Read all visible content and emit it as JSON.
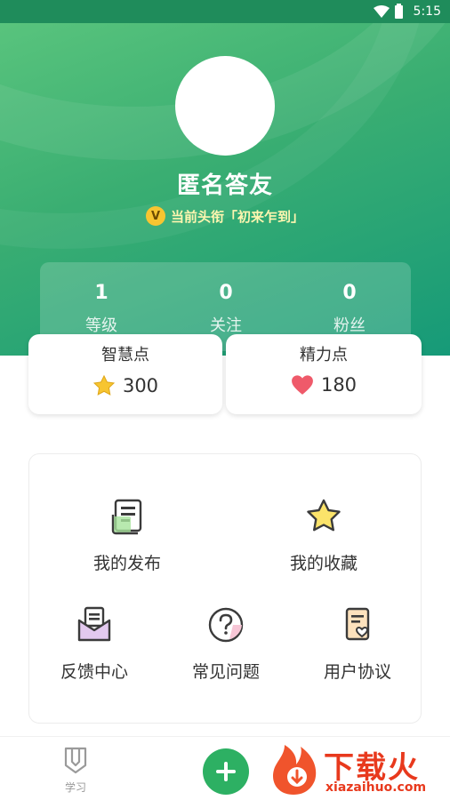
{
  "status": {
    "time": "5:15"
  },
  "profile": {
    "nickname": "匿名答友",
    "title_badge": "V",
    "title_text": "当前头衔「初来乍到」"
  },
  "stats": [
    {
      "value": "1",
      "label": "等级"
    },
    {
      "value": "0",
      "label": "关注"
    },
    {
      "value": "0",
      "label": "粉丝"
    }
  ],
  "points": {
    "wisdom": {
      "label": "智慧点",
      "value": "300",
      "icon": "star-icon"
    },
    "energy": {
      "label": "精力点",
      "value": "180",
      "icon": "heart-icon"
    }
  },
  "menu": {
    "publish": "我的发布",
    "favorites": "我的收藏",
    "feedback": "反馈中心",
    "faq": "常见问题",
    "agreement": "用户协议"
  },
  "tabbar": {
    "study_label": "学习"
  },
  "watermark": {
    "main": "下载火",
    "sub": "xiazaihuo.com"
  },
  "colors": {
    "accent": "#2db063",
    "title_text": "#fff6b0",
    "energy": "#ef5a6a",
    "star": "#f7c531"
  }
}
